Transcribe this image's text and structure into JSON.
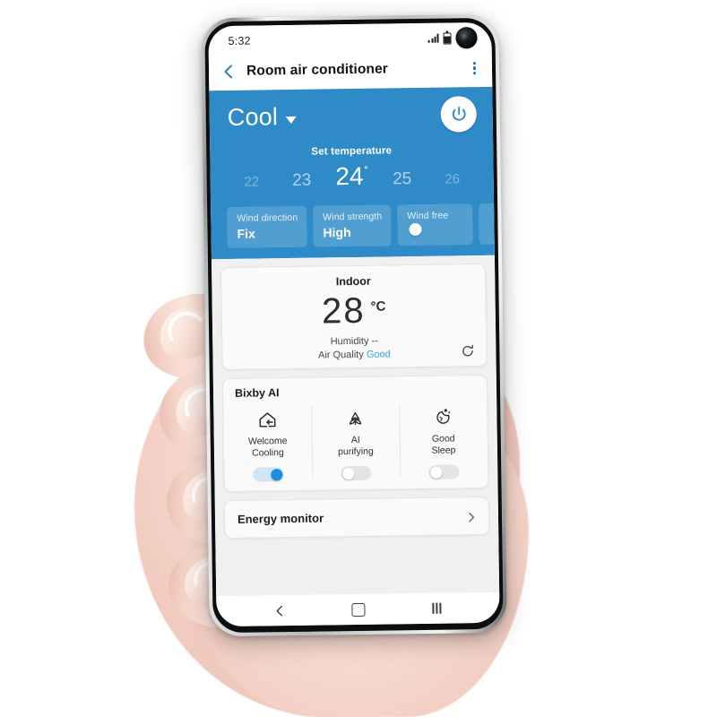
{
  "status_bar": {
    "time": "5:32",
    "icons": [
      "signal-icon",
      "battery-icon",
      "camera-punch-hole"
    ]
  },
  "app_bar": {
    "back_icon": "chevron-left-icon",
    "title": "Room air conditioner",
    "more_icon": "kebab-menu-icon"
  },
  "hero": {
    "accent_color": "#2e8bc8",
    "mode": "Cool",
    "mode_caret_icon": "caret-down-icon",
    "power_icon": "power-icon",
    "set_temperature_label": "Set temperature",
    "temperatures": [
      {
        "value": "22",
        "state": "far"
      },
      {
        "value": "23",
        "state": "near"
      },
      {
        "value": "24",
        "state": "selected",
        "degree": "˚"
      },
      {
        "value": "25",
        "state": "near"
      },
      {
        "value": "26",
        "state": "far"
      }
    ],
    "chips": [
      {
        "key": "Wind direction",
        "value": "Fix",
        "type": "value"
      },
      {
        "key": "Wind strength",
        "value": "High",
        "type": "value"
      },
      {
        "key": "Wind free",
        "value": "",
        "type": "toggle",
        "toggle_on": false
      }
    ]
  },
  "indoor": {
    "title": "Indoor",
    "temperature": "28",
    "unit": "°C",
    "humidity_label": "Humidity --",
    "air_quality_label": "Air Quality",
    "air_quality_value": "Good",
    "air_quality_color": "#34a5e0",
    "refresh_icon": "refresh-icon"
  },
  "bixby": {
    "title": "Bixby AI",
    "items": [
      {
        "icon": "house-arrow-icon",
        "line1": "Welcome",
        "line2": "Cooling",
        "toggle_on": true
      },
      {
        "icon": "butterfly-purify-icon",
        "line1": "AI",
        "line2": "purifying",
        "toggle_on": false
      },
      {
        "icon": "moon-stars-icon",
        "line1": "Good",
        "line2": "Sleep",
        "toggle_on": false
      }
    ]
  },
  "energy": {
    "label": "Energy monitor",
    "chevron_icon": "chevron-right-icon"
  },
  "nav_bar": {
    "back_icon": "nav-back-icon",
    "home_icon": "nav-home-icon",
    "recents_icon": "nav-recents-icon"
  }
}
